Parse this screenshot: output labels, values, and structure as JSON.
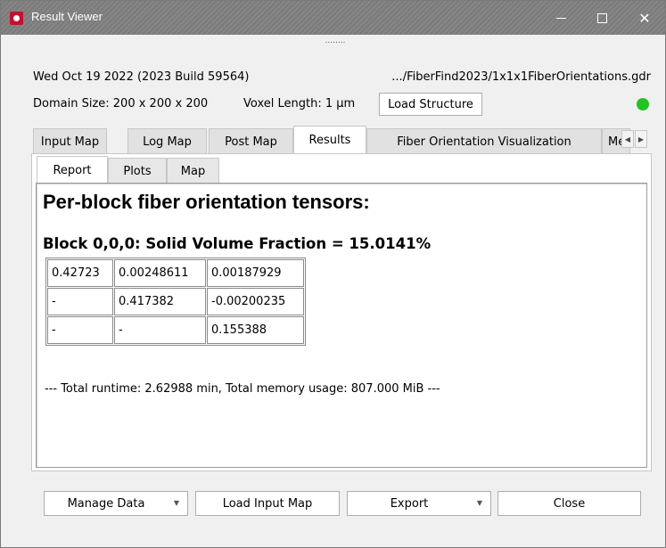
{
  "window": {
    "title": "Result Viewer",
    "minimize_label": "",
    "maximize_label": "",
    "close_label": "✕"
  },
  "splitter_handle": "........",
  "header": {
    "date_build": "Wed Oct 19 2022 (2023 Build 59564)",
    "file_path": ".../FiberFind2023/1x1x1FiberOrientations.gdr",
    "domain_size": "Domain Size: 200 x 200 x 200",
    "voxel_length": "Voxel Length: 1 μm",
    "load_structure_label": "Load Structure",
    "status_color": "#22c322"
  },
  "tabs": [
    {
      "label": "Input Map",
      "active": false
    },
    {
      "label": "Log Map",
      "active": false
    },
    {
      "label": "Post Map",
      "active": false
    },
    {
      "label": "Results",
      "active": true
    },
    {
      "label": "Fiber Orientation Visualization",
      "active": false
    },
    {
      "label": "Met",
      "active": false
    }
  ],
  "tab_scroll": {
    "left": "◀",
    "right": "▶"
  },
  "subtabs": [
    {
      "label": "Report",
      "active": true
    },
    {
      "label": "Plots",
      "active": false
    },
    {
      "label": "Map",
      "active": false
    }
  ],
  "report": {
    "heading": "Per-block fiber orientation tensors:",
    "block_heading": "Block 0,0,0: Solid Volume Fraction = 15.0141%",
    "tensor_rows": [
      [
        "0.42723",
        "0.00248611",
        "0.00187929"
      ],
      [
        "-",
        "0.417382",
        "-0.00200235"
      ],
      [
        "-",
        "-",
        "0.155388"
      ]
    ],
    "runtime_line": "--- Total runtime: 2.62988 min, Total memory usage: 807.000 MiB ---"
  },
  "buttons": {
    "manage_data": "Manage Data",
    "load_input_map": "Load Input Map",
    "export": "Export",
    "close": "Close",
    "dropdown_arrow": "▼"
  }
}
